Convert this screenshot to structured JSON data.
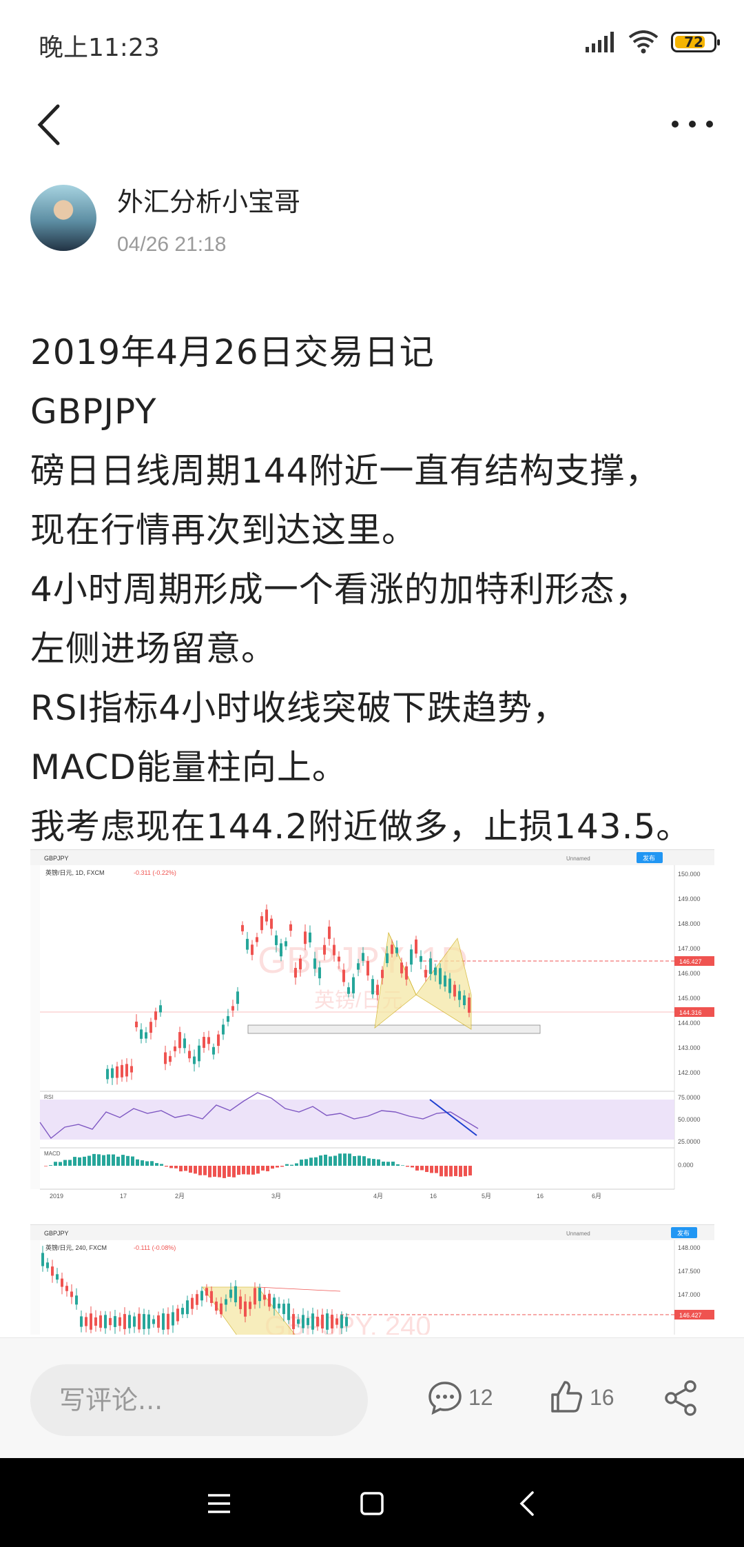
{
  "status": {
    "time": "晚上11:23",
    "battery": "72",
    "icons": [
      "signal-icon",
      "wifi-icon",
      "battery-icon"
    ]
  },
  "header": {
    "back_icon": "chevron-left-icon",
    "more_icon": "more-horizontal-icon"
  },
  "author": {
    "name": "外汇分析小宝哥",
    "time": "04/26 21:18"
  },
  "article": {
    "lines": [
      "2019年4月26日交易日记",
      "GBPJPY",
      "磅日日线周期144附近一直有结构支撑，",
      "现在行情再次到达这里。",
      "4小时周期形成一个看涨的加特利形态，",
      "左侧进场留意。",
      "RSI指标4小时收线突破下跌趋势，",
      "MACD能量柱向上。",
      "我考虑现在144.2附近做多，止损143.5。"
    ]
  },
  "chart1": {
    "symbol": "GBPJPY",
    "legend": "英镑/日元, 1D, FXCM",
    "change": "-0.311 (-0.22%)",
    "watermark": "GBPJPY, 1D",
    "watermark_sub": "英镑/日元",
    "unnamed": "Unnamed",
    "publish": "发布",
    "price_labels": [
      "150.000",
      "149.000",
      "148.000",
      "147.000",
      "146.000",
      "145.000",
      "144.000",
      "143.000",
      "142.000"
    ],
    "tag_red": "146.427",
    "tag_red2": "144.316",
    "rsi_label": "RSI",
    "rsi_labels": [
      "75.0000",
      "50.0000",
      "25.0000"
    ],
    "macd_label": "MACD",
    "macd_value": "0.000",
    "x_labels": [
      "2019",
      "17",
      "2月",
      "3月",
      "4月",
      "16",
      "5月",
      "16",
      "6月"
    ]
  },
  "chart2": {
    "symbol": "GBPJPY",
    "legend": "英镑/日元, 240, FXCM",
    "change": "-0.111 (-0.08%)",
    "watermark": "GBPJPY, 240",
    "unnamed": "Unnamed",
    "publish": "发布",
    "price_labels": [
      "148.000",
      "147.500",
      "147.000"
    ],
    "tag_red": "146.427"
  },
  "bottom_bar": {
    "comment_placeholder": "写评论...",
    "comment_count": "12",
    "like_count": "16",
    "comment_icon": "comment-icon",
    "like_icon": "thumbs-up-icon",
    "share_icon": "share-icon"
  },
  "nav": {
    "icons": [
      "menu-icon",
      "home-square-icon",
      "back-icon"
    ]
  },
  "colors": {
    "up": "#26a69a",
    "down": "#ef5350",
    "rsi": "#7e57c2",
    "pattern": "#f5e6a0"
  }
}
